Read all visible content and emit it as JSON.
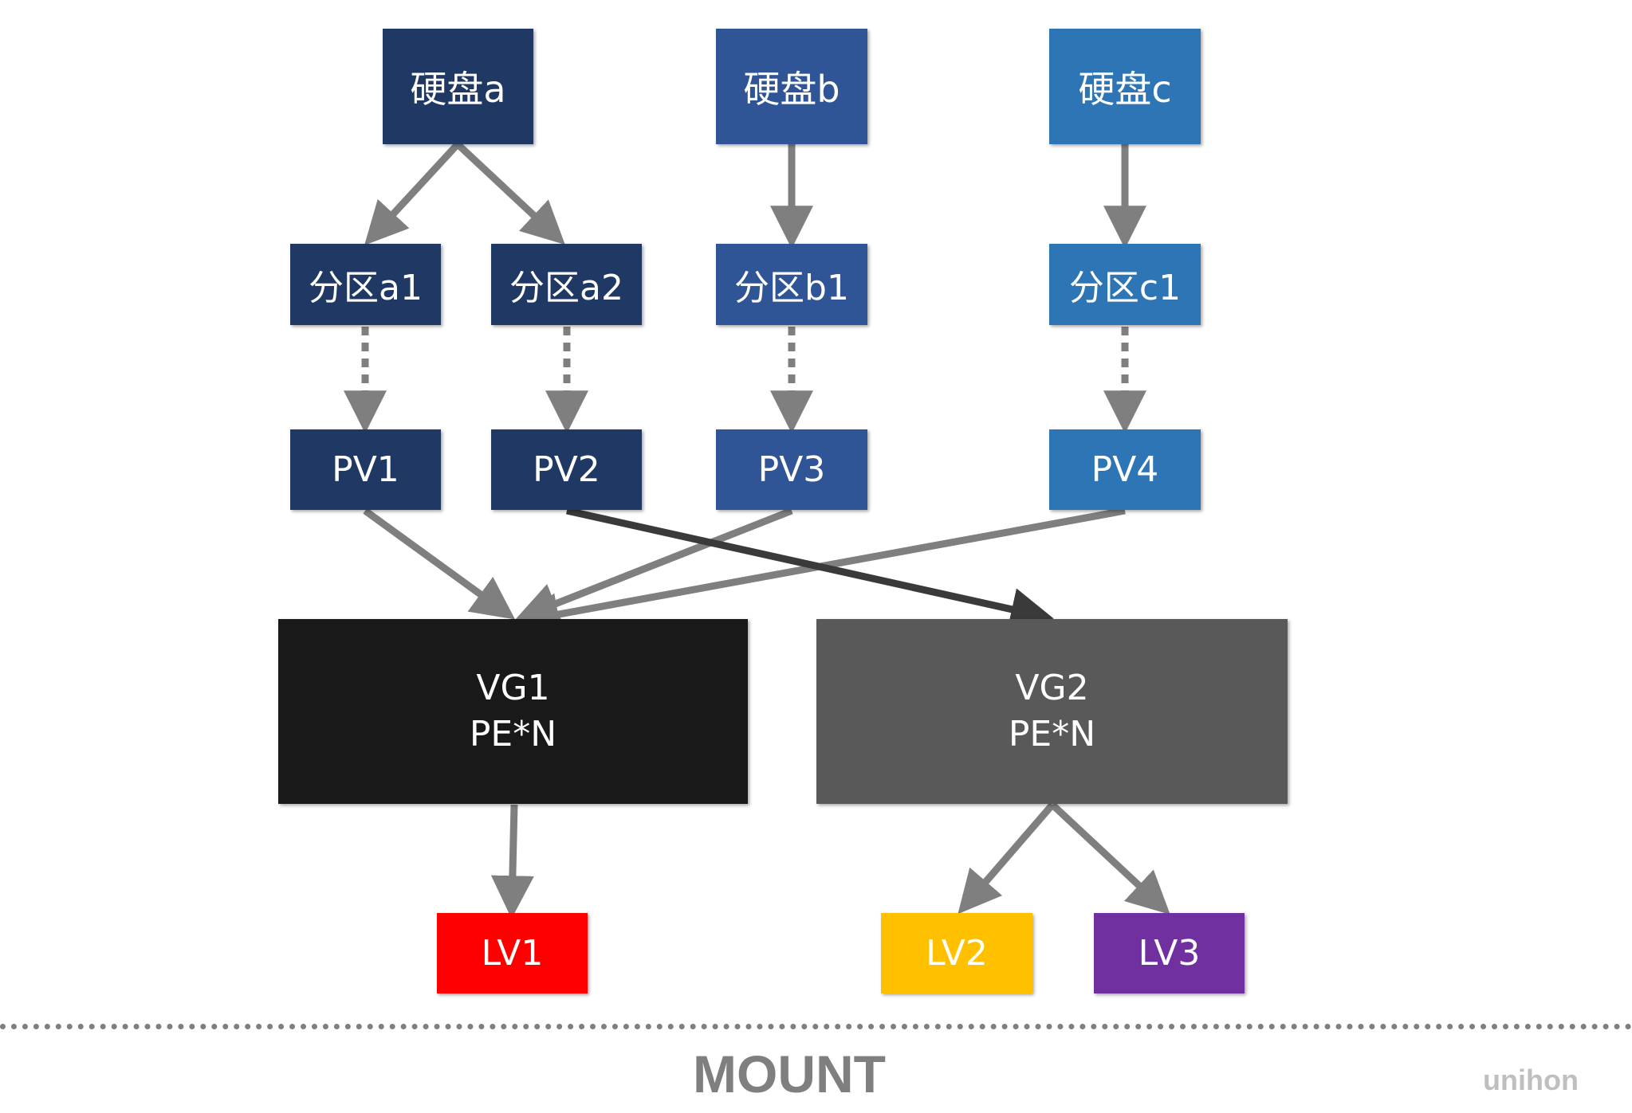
{
  "disks": {
    "a": "硬盘a",
    "b": "硬盘b",
    "c": "硬盘c"
  },
  "partitions": {
    "a1": "分区a1",
    "a2": "分区a2",
    "b1": "分区b1",
    "c1": "分区c1"
  },
  "pvs": {
    "pv1": "PV1",
    "pv2": "PV2",
    "pv3": "PV3",
    "pv4": "PV4"
  },
  "vgs": {
    "vg1": {
      "name": "VG1",
      "extents": "PE*N"
    },
    "vg2": {
      "name": "VG2",
      "extents": "PE*N"
    }
  },
  "lvs": {
    "lv1": "LV1",
    "lv2": "LV2",
    "lv3": "LV3"
  },
  "footer": {
    "mount_label": "MOUNT",
    "watermark": "unihon"
  },
  "colors": {
    "disk_a": "#203864",
    "disk_b": "#2f5597",
    "disk_c": "#2e75b6",
    "vg1": "#191919",
    "vg2": "#595959",
    "lv1": "#ff0000",
    "lv2": "#ffc000",
    "lv3": "#7030a0",
    "arrow": "#7f7f7f",
    "arrow_dark": "#3a3a3a"
  }
}
